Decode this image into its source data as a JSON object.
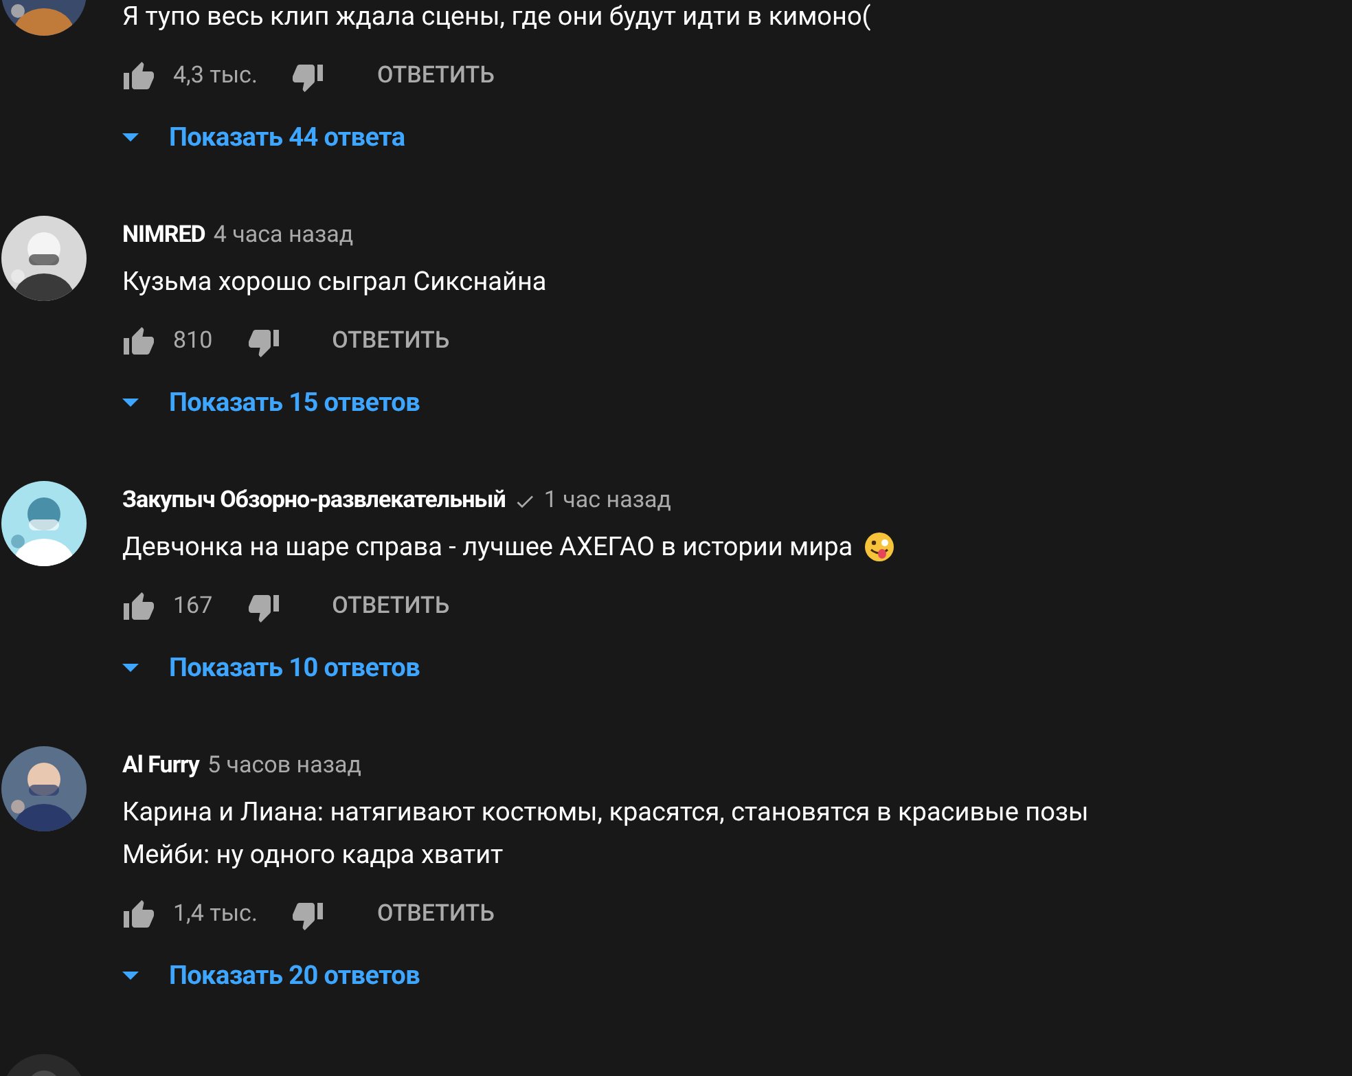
{
  "comments": [
    {
      "text": "Я тупо весь клип ждала сцены, где они будут идти в кимоно(",
      "likes": "4,3 тыс.",
      "reply": "ОТВЕТИТЬ",
      "replies": "Показать 44 ответа"
    },
    {
      "author": "NIMRED",
      "time": "4 часа назад",
      "text": "Кузьма хорошо сыграл Сикснайна",
      "likes": "810",
      "reply": "ОТВЕТИТЬ",
      "replies": "Показать 15 ответов"
    },
    {
      "author": "Закупыч Обзорно-развлекательный",
      "verified": true,
      "time": "1 час назад",
      "text": "Девчонка на шаре справа - лучшее АХЕГАО в истории мира",
      "emoji": true,
      "likes": "167",
      "reply": "ОТВЕТИТЬ",
      "replies": "Показать 10 ответов"
    },
    {
      "author": "Al Furry",
      "time": "5 часов назад",
      "text": "Карина и Лиана: натягивают костюмы, красятся, становятся в красивые позы\nМейби: ну одного кадра хватит",
      "likes": "1,4 тыс.",
      "reply": "ОТВЕТИТЬ",
      "replies": "Показать 20 ответов"
    }
  ]
}
